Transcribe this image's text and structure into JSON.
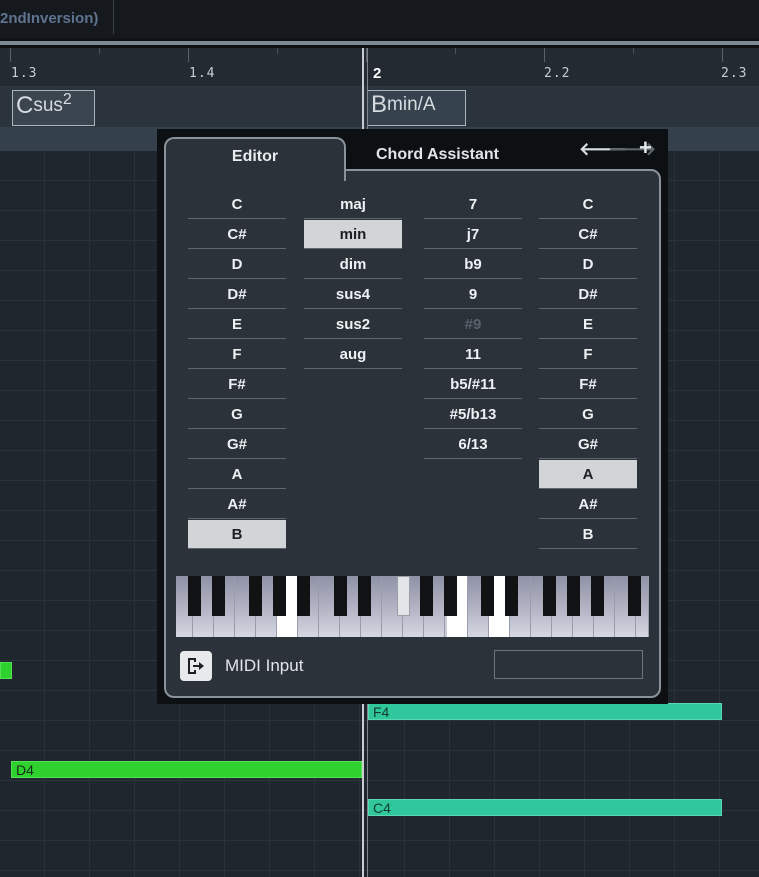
{
  "top_label": "2ndInversion)",
  "ruler": {
    "labels": [
      "1.3",
      "1.4",
      "2",
      "2.2",
      "2.3"
    ]
  },
  "chord_track": {
    "chord1": {
      "root": "C",
      "quality": "sus",
      "sup": "2"
    },
    "chord2": {
      "root": "B",
      "quality": "min/A"
    }
  },
  "notes": {
    "d4": "D4",
    "f4": "F4",
    "c4": "C4"
  },
  "popup": {
    "tabs": {
      "editor": "Editor",
      "assistant": "Chord Assistant"
    },
    "nav": {
      "back": "🡐",
      "forward": "🡒",
      "add": "+"
    },
    "root_notes": [
      "C",
      "C#",
      "D",
      "D#",
      "E",
      "F",
      "F#",
      "G",
      "G#",
      "A",
      "A#",
      "B"
    ],
    "root_selected": "B",
    "types": [
      "maj",
      "min",
      "dim",
      "sus4",
      "sus2",
      "aug"
    ],
    "type_selected": "min",
    "tensions": [
      "7",
      "j7",
      "b9",
      "9",
      "#9",
      "11",
      "b5/#11",
      "#5/b13",
      "6/13"
    ],
    "tension_disabled": "#9",
    "bass_notes": [
      "C",
      "C#",
      "D",
      "D#",
      "E",
      "F",
      "F#",
      "G",
      "G#",
      "A",
      "A#",
      "B"
    ],
    "bass_selected": "A",
    "midi_input_label": "MIDI Input",
    "midi_input_value": ""
  },
  "colors": {
    "green_note": "#2ed12e",
    "teal_note": "#2fc79b",
    "selected_cell": "#d2d5d8"
  }
}
